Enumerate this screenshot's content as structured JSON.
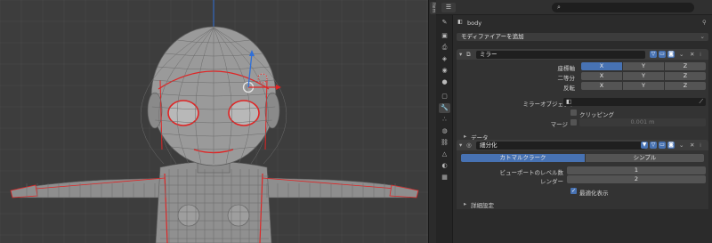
{
  "viewport": {
    "colors": {
      "background": "#3d3d3d",
      "grid": "#4a4a4a",
      "mesh": "#b7b7b7",
      "seam": "#e02424",
      "axis_blue": "#2f6fd8"
    }
  },
  "side_tab": {
    "label": "Item"
  },
  "properties": {
    "header": {
      "editor_icon": "properties-editor-icon",
      "search_placeholder": ""
    },
    "object_name": "body",
    "add_modifier": "モディファイアーを追加",
    "mirror": {
      "name": "ミラー",
      "axis_label": "座標軸",
      "bisect_label": "二等分",
      "flip_label": "反転",
      "x": "X",
      "y": "Y",
      "z": "Z",
      "mirror_object_label": "ミラーオブジェクト",
      "clipping_label": "クリッピング",
      "merge_label": "マージ",
      "merge_value": "0.001 m",
      "data_label": "データ"
    },
    "subdivision": {
      "name": "細分化",
      "tab_catmull": "カトマルクラーク",
      "tab_simple": "シンプル",
      "viewport_levels_label": "ビューポートのレベル数",
      "viewport_levels_value": "1",
      "render_label": "レンダー",
      "render_value": "2",
      "optimal_display_label": "最適化表示",
      "advanced_label": "詳細設定"
    },
    "accent_color": "#4772b3"
  }
}
